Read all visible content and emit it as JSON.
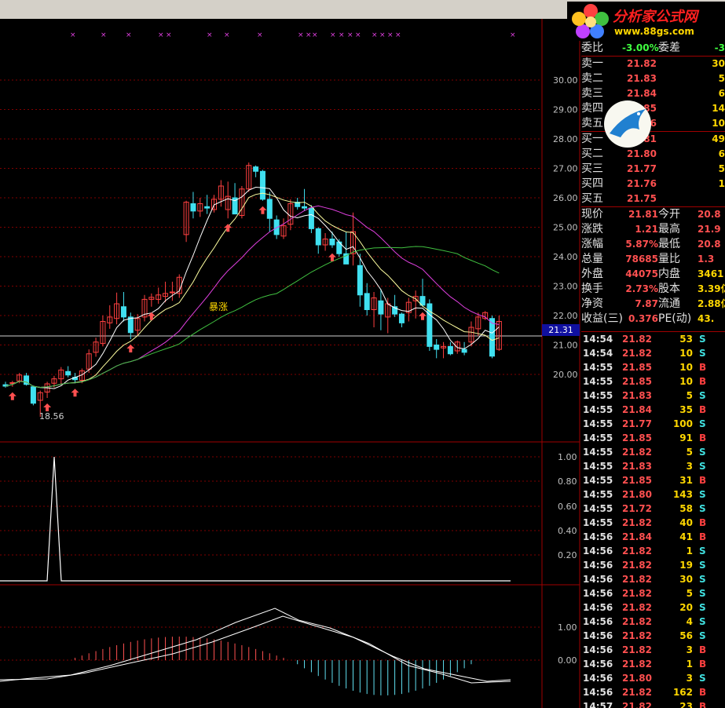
{
  "logo": {
    "title": "分析家公式网",
    "url": "www.88gs.com"
  },
  "axis": {
    "main": [
      "30.00",
      "29.00",
      "28.00",
      "27.00",
      "26.00",
      "25.00",
      "24.00",
      "23.00",
      "22.00",
      "21.00",
      "20.00"
    ],
    "sub1": [
      "1.00",
      "0.80",
      "0.60",
      "0.40",
      "0.20"
    ],
    "sub2": [
      "1.00",
      "0.00"
    ],
    "current_price_tag": "21.31"
  },
  "annotations": {
    "low_label": "18.56",
    "surge_label": "暴涨"
  },
  "quote": {
    "weibi": {
      "label": "委比",
      "value": "-3.00%",
      "label2": "委差",
      "value2": "-3"
    },
    "sell": [
      {
        "label": "卖五",
        "price": "21.86",
        "vol": "10"
      },
      {
        "label": "卖四",
        "price": "21.85",
        "vol": "14"
      },
      {
        "label": "卖三",
        "price": "21.84",
        "vol": "6"
      },
      {
        "label": "卖二",
        "price": "21.83",
        "vol": "5"
      },
      {
        "label": "卖一",
        "price": "21.82",
        "vol": "30"
      }
    ],
    "buy": [
      {
        "label": "买一",
        "price": "21.81",
        "vol": "49"
      },
      {
        "label": "买二",
        "price": "21.80",
        "vol": "6"
      },
      {
        "label": "买三",
        "price": "21.77",
        "vol": "5"
      },
      {
        "label": "买四",
        "price": "21.76",
        "vol": "1"
      },
      {
        "label": "买五",
        "price": "21.75",
        "vol": ""
      }
    ],
    "stats": [
      {
        "l1": "现价",
        "v1": "21.81",
        "l2": "今开",
        "v2": "20.8"
      },
      {
        "l1": "涨跌",
        "v1": "1.21",
        "l2": "最高",
        "v2": "21.9"
      },
      {
        "l1": "涨幅",
        "v1": "5.87%",
        "l2": "最低",
        "v2": "20.8"
      },
      {
        "l1": "总量",
        "v1": "78685",
        "l2": "量比",
        "v2": "1.3"
      },
      {
        "l1": "外盘",
        "v1": "44075",
        "l2": "内盘",
        "v2": "3461"
      },
      {
        "l1": "换手",
        "v1": "2.73%",
        "l2": "股本",
        "v2": "3.39亿"
      },
      {
        "l1": "净资",
        "v1": "7.87",
        "l2": "流通",
        "v2": "2.88亿"
      },
      {
        "l1": "收益(三)",
        "v1": "0.376",
        "l2": "PE(动)",
        "v2": "43."
      }
    ],
    "ticks": [
      {
        "t": "14:54",
        "p": "21.82",
        "v": "53",
        "d": "S"
      },
      {
        "t": "14:54",
        "p": "21.82",
        "v": "10",
        "d": "S"
      },
      {
        "t": "14:55",
        "p": "21.85",
        "v": "10",
        "d": "B"
      },
      {
        "t": "14:55",
        "p": "21.85",
        "v": "10",
        "d": "B"
      },
      {
        "t": "14:55",
        "p": "21.83",
        "v": "5",
        "d": "S"
      },
      {
        "t": "14:55",
        "p": "21.84",
        "v": "35",
        "d": "B"
      },
      {
        "t": "14:55",
        "p": "21.77",
        "v": "100",
        "d": "S"
      },
      {
        "t": "14:55",
        "p": "21.85",
        "v": "91",
        "d": "B"
      },
      {
        "t": "14:55",
        "p": "21.82",
        "v": "5",
        "d": "S"
      },
      {
        "t": "14:55",
        "p": "21.83",
        "v": "3",
        "d": "S"
      },
      {
        "t": "14:55",
        "p": "21.85",
        "v": "31",
        "d": "B"
      },
      {
        "t": "14:55",
        "p": "21.80",
        "v": "143",
        "d": "S"
      },
      {
        "t": "14:55",
        "p": "21.72",
        "v": "58",
        "d": "S"
      },
      {
        "t": "14:55",
        "p": "21.82",
        "v": "40",
        "d": "B"
      },
      {
        "t": "14:56",
        "p": "21.84",
        "v": "41",
        "d": "B"
      },
      {
        "t": "14:56",
        "p": "21.82",
        "v": "1",
        "d": "S"
      },
      {
        "t": "14:56",
        "p": "21.82",
        "v": "19",
        "d": "S"
      },
      {
        "t": "14:56",
        "p": "21.82",
        "v": "30",
        "d": "S"
      },
      {
        "t": "14:56",
        "p": "21.82",
        "v": "5",
        "d": "S"
      },
      {
        "t": "14:56",
        "p": "21.82",
        "v": "20",
        "d": "S"
      },
      {
        "t": "14:56",
        "p": "21.82",
        "v": "4",
        "d": "S"
      },
      {
        "t": "14:56",
        "p": "21.82",
        "v": "56",
        "d": "S"
      },
      {
        "t": "14:56",
        "p": "21.82",
        "v": "3",
        "d": "B"
      },
      {
        "t": "14:56",
        "p": "21.82",
        "v": "1",
        "d": "B"
      },
      {
        "t": "14:56",
        "p": "21.80",
        "v": "3",
        "d": "S"
      },
      {
        "t": "14:56",
        "p": "21.82",
        "v": "162",
        "d": "B"
      },
      {
        "t": "14:57",
        "p": "21.82",
        "v": "23",
        "d": "B"
      }
    ]
  },
  "colors": {
    "up": "#ff4040",
    "down": "#40e0f0",
    "ma5": "#ffffff",
    "ma10": "#ffffa0",
    "ma20": "#e040e0",
    "ma60": "#40c040",
    "grid": "#800000"
  },
  "chart_data": {
    "type": "candlestick",
    "candles": [
      [
        19.65,
        19.75,
        19.55,
        19.6
      ],
      [
        19.7,
        19.78,
        19.58,
        19.72
      ],
      [
        19.78,
        20.05,
        19.7,
        19.98
      ],
      [
        19.95,
        20.05,
        19.62,
        19.66
      ],
      [
        19.58,
        19.62,
        18.95,
        19.02
      ],
      [
        19.12,
        19.45,
        18.56,
        19.38
      ],
      [
        19.4,
        19.75,
        19.2,
        19.68
      ],
      [
        19.7,
        19.95,
        19.55,
        19.85
      ],
      [
        19.85,
        20.25,
        19.65,
        20.15
      ],
      [
        20.1,
        20.28,
        19.9,
        19.98
      ],
      [
        19.9,
        20.05,
        19.7,
        19.82
      ],
      [
        19.8,
        20.2,
        19.7,
        20.12
      ],
      [
        20.18,
        20.85,
        20.05,
        20.7
      ],
      [
        20.75,
        21.25,
        20.6,
        21.1
      ],
      [
        21.05,
        22.0,
        20.95,
        21.8
      ],
      [
        21.75,
        22.35,
        21.55,
        21.95
      ],
      [
        21.9,
        22.78,
        21.7,
        22.4
      ],
      [
        22.3,
        22.8,
        21.8,
        21.95
      ],
      [
        21.95,
        22.1,
        21.2,
        21.42
      ],
      [
        21.5,
        22.05,
        21.3,
        21.9
      ],
      [
        21.95,
        22.7,
        21.8,
        22.55
      ],
      [
        22.55,
        22.75,
        22.3,
        22.62
      ],
      [
        22.55,
        22.95,
        22.4,
        22.7
      ],
      [
        22.65,
        23.15,
        22.45,
        22.75
      ],
      [
        22.8,
        23.15,
        22.5,
        22.8
      ],
      [
        22.75,
        23.4,
        22.6,
        23.3
      ],
      [
        24.75,
        25.9,
        24.5,
        25.85
      ],
      [
        25.8,
        26.2,
        25.3,
        25.55
      ],
      [
        25.55,
        26.0,
        25.35,
        25.8
      ],
      [
        25.7,
        26.1,
        25.45,
        25.65
      ],
      [
        25.6,
        26.1,
        25.5,
        25.95
      ],
      [
        25.95,
        26.6,
        25.7,
        26.4
      ],
      [
        25.6,
        26.55,
        25.3,
        26.05
      ],
      [
        26.0,
        26.5,
        25.7,
        25.45
      ],
      [
        25.4,
        26.4,
        25.3,
        26.3
      ],
      [
        26.3,
        27.2,
        26.2,
        27.1
      ],
      [
        27.05,
        27.1,
        26.7,
        26.9
      ],
      [
        26.9,
        26.95,
        25.9,
        25.95
      ],
      [
        25.95,
        26.2,
        24.85,
        25.3
      ],
      [
        25.25,
        25.4,
        24.6,
        24.75
      ],
      [
        24.7,
        25.3,
        24.6,
        25.05
      ],
      [
        25.1,
        25.95,
        24.9,
        25.8
      ],
      [
        25.85,
        26.0,
        25.6,
        25.7
      ],
      [
        25.7,
        26.3,
        25.55,
        25.65
      ],
      [
        25.65,
        25.75,
        24.8,
        24.95
      ],
      [
        24.95,
        25.0,
        24.1,
        24.4
      ],
      [
        24.4,
        24.8,
        24.2,
        24.6
      ],
      [
        24.6,
        24.85,
        24.3,
        24.4
      ],
      [
        24.5,
        24.6,
        24.0,
        24.1
      ],
      [
        24.1,
        24.85,
        23.8,
        23.75
      ],
      [
        24.1,
        25.5,
        23.7,
        24.85
      ],
      [
        23.7,
        24.1,
        22.3,
        22.7
      ],
      [
        22.75,
        23.1,
        22.0,
        22.2
      ],
      [
        22.2,
        22.8,
        21.6,
        22.6
      ],
      [
        22.5,
        22.9,
        21.5,
        22.05
      ],
      [
        21.95,
        22.6,
        21.4,
        22.4
      ],
      [
        22.3,
        22.7,
        21.95,
        22.05
      ],
      [
        22.05,
        22.1,
        21.6,
        21.75
      ],
      [
        22.1,
        22.6,
        21.8,
        22.45
      ],
      [
        22.5,
        22.85,
        21.9,
        22.65
      ],
      [
        22.65,
        23.25,
        22.3,
        22.35
      ],
      [
        22.4,
        22.55,
        20.8,
        20.95
      ],
      [
        21.0,
        21.2,
        20.55,
        20.85
      ],
      [
        20.9,
        21.1,
        20.55,
        20.95
      ],
      [
        20.95,
        21.1,
        20.65,
        20.7
      ],
      [
        20.8,
        21.15,
        20.7,
        21.1
      ],
      [
        20.85,
        21.1,
        20.65,
        20.75
      ],
      [
        21.1,
        21.8,
        20.95,
        21.6
      ],
      [
        21.55,
        22.1,
        21.3,
        21.95
      ],
      [
        21.9,
        22.15,
        21.85,
        22.1
      ],
      [
        21.9,
        22.0,
        20.55,
        20.62
      ],
      [
        20.85,
        22.0,
        20.8,
        21.8
      ]
    ],
    "buy_arrows_bar": [
      1,
      6,
      10,
      18,
      21,
      32,
      37,
      47,
      60,
      75,
      80
    ],
    "ylim": [
      18.5,
      30.6
    ]
  }
}
